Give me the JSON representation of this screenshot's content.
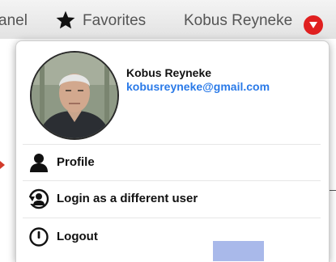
{
  "topbar": {
    "partial_label": "anel",
    "favorites_label": "Favorites",
    "user_name": "Kobus Reyneke",
    "star_icon": "star-icon",
    "caret_icon": "chevron-down-icon",
    "accent_color": "#e02020"
  },
  "dropdown": {
    "user": {
      "name": "Kobus Reyneke",
      "email": "kobusreyneke@gmail.com",
      "avatar_icon": "user-photo"
    },
    "menu": [
      {
        "label": "Profile",
        "icon": "user-icon"
      },
      {
        "label": "Login as a different user",
        "icon": "switch-user-icon"
      },
      {
        "label": "Logout",
        "icon": "power-icon"
      }
    ],
    "email_color": "#2a7ae8"
  }
}
